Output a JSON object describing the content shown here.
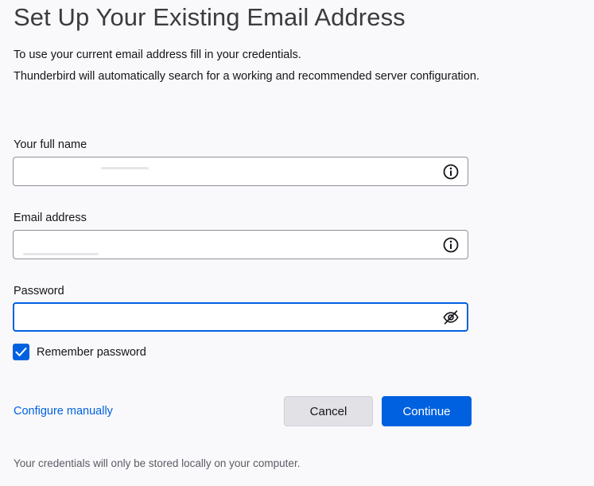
{
  "header": {
    "title": "Set Up Your Existing Email Address",
    "description_line1": "To use your current email address fill in your credentials.",
    "description_line2": "Thunderbird will automatically search for a working and recommended server configuration."
  },
  "form": {
    "full_name": {
      "label": "Your full name",
      "value": "",
      "icon": "info-icon"
    },
    "email": {
      "label": "Email address",
      "value": "",
      "icon": "info-icon"
    },
    "password": {
      "label": "Password",
      "value": "",
      "icon": "eye-slash-icon"
    },
    "remember_password": {
      "label": "Remember password",
      "checked": true
    }
  },
  "actions": {
    "configure_manually": "Configure manually",
    "cancel": "Cancel",
    "continue": "Continue"
  },
  "footer": {
    "note": "Your credentials will only be stored locally on your computer."
  },
  "colors": {
    "accent": "#0061e0",
    "page_background": "#f9f9fb",
    "secondary_button": "#e2e2e6"
  }
}
